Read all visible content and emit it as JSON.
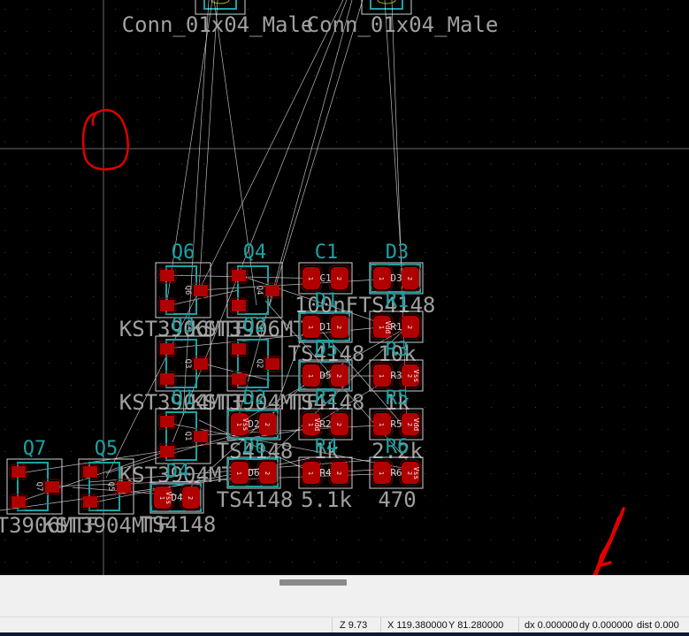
{
  "colors": {
    "background": "#000000",
    "pad": "#b00000",
    "courtyard": "#d0d0d0",
    "fab": "#1aa3a3",
    "ref_text": "#1aa3a3",
    "value_text": "#a0a0a0",
    "ratsnest": "#e8e8e8",
    "annotation": "#e00000"
  },
  "connectors": [
    {
      "value": "Conn_01x04_Male"
    },
    {
      "value": "Conn_01x04_Male"
    }
  ],
  "transistors": [
    {
      "ref": "Q6",
      "value": "KST3906MTF"
    },
    {
      "ref": "Q4",
      "value": "KST3906MTF"
    },
    {
      "ref": "Q3",
      "value": "KST3904MTF"
    },
    {
      "ref": "Q2",
      "value": "KST3904MTF"
    },
    {
      "ref": "Q1",
      "value": "KST3904MTF"
    },
    {
      "ref": "Q7",
      "value": "KST3906MTF"
    },
    {
      "ref": "Q5",
      "value": "KST3904MTF"
    }
  ],
  "twopins": [
    {
      "ref": "C1",
      "value": "100nF",
      "tag1": "",
      "tag2": ""
    },
    {
      "ref": "D3",
      "value": "TS4148",
      "tag1": "",
      "tag2": ""
    },
    {
      "ref": "D1",
      "value": "TS4148",
      "tag1": "",
      "tag2": ""
    },
    {
      "ref": "R1",
      "value": "10k",
      "tag1": "Vdd",
      "tag2": ""
    },
    {
      "ref": "D5",
      "value": "TS4148",
      "tag1": "",
      "tag2": ""
    },
    {
      "ref": "R3",
      "value": "1k",
      "tag1": "",
      "tag2": "Vss"
    },
    {
      "ref": "D2",
      "value": "TS4148",
      "tag1": "Vss",
      "tag2": ""
    },
    {
      "ref": "R2",
      "value": "1k",
      "tag1": "Vdd",
      "tag2": ""
    },
    {
      "ref": "R5",
      "value": "2.2k",
      "tag1": "",
      "tag2": "Vdd"
    },
    {
      "ref": "D6",
      "value": "TS4148",
      "tag1": "",
      "tag2": ""
    },
    {
      "ref": "R4",
      "value": "5.1k",
      "tag1": "",
      "tag2": ""
    },
    {
      "ref": "R6",
      "value": "470",
      "tag1": "",
      "tag2": "Vss"
    },
    {
      "ref": "D4",
      "value": "TS4148",
      "tag1": "Vss",
      "tag2": ""
    }
  ],
  "pad_numbers": [
    "1",
    "2"
  ],
  "scrollbar": {
    "position_percent": 45
  },
  "status": {
    "zoom": "Z 9.73",
    "x": "X 119.380000",
    "y": "Y 81.280000",
    "dx": "dx 0.000000",
    "dy": "dy 0.000000",
    "dist": "dist 0.000"
  }
}
